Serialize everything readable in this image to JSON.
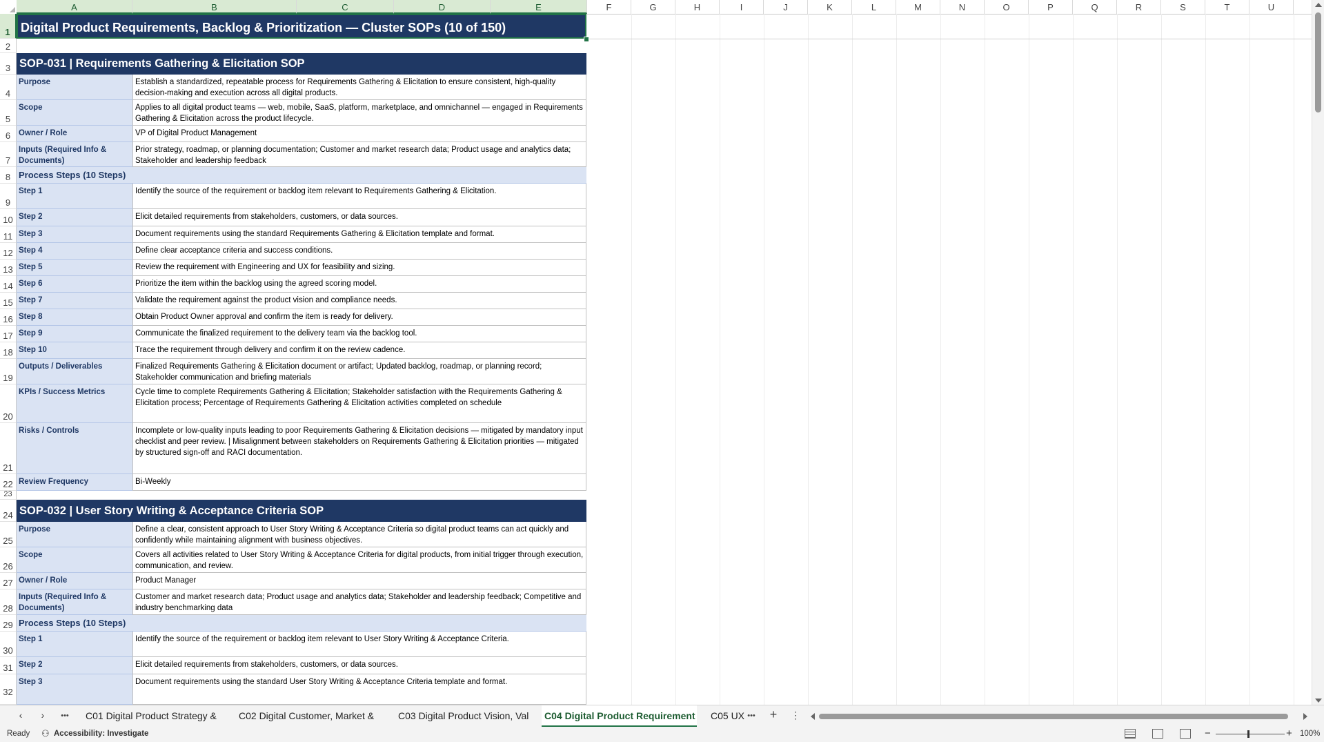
{
  "columns": [
    "A",
    "B",
    "C",
    "D",
    "E",
    "F",
    "G",
    "H",
    "I",
    "J",
    "K",
    "L",
    "M",
    "N",
    "O",
    "P",
    "Q",
    "R",
    "S",
    "T",
    "U"
  ],
  "rows": [
    "1",
    "2",
    "3",
    "4",
    "5",
    "6",
    "7",
    "8",
    "9",
    "10",
    "11",
    "12",
    "13",
    "14",
    "15",
    "16",
    "17",
    "18",
    "19",
    "20",
    "21",
    "22",
    "23",
    "24",
    "25",
    "26",
    "27",
    "28",
    "29",
    "30",
    "31",
    "32"
  ],
  "sheet_title": "Digital Product Requirements, Backlog & Prioritization  —  Cluster SOPs (10 of 150)",
  "sop1": {
    "header": "SOP-031  |  Requirements Gathering & Elicitation SOP",
    "purpose_label": "Purpose",
    "purpose": "Establish a standardized, repeatable process for Requirements Gathering & Elicitation to ensure consistent, high-quality decision-making and execution across all digital products.",
    "scope_label": "Scope",
    "scope": "Applies to all digital product teams — web, mobile, SaaS, platform, marketplace, and omnichannel — engaged in Requirements Gathering & Elicitation across the product lifecycle.",
    "owner_label": "Owner / Role",
    "owner": "VP of Digital Product Management",
    "inputs_label": "Inputs (Required Info & Documents)",
    "inputs": "Prior strategy, roadmap, or planning documentation; Customer and market research data; Product usage and analytics data; Stakeholder and leadership feedback",
    "steps_band": "Process Steps (10 Steps)",
    "steps": [
      {
        "label": "Step 1",
        "text": "Identify the source of the requirement or backlog item relevant to Requirements Gathering & Elicitation."
      },
      {
        "label": "Step 2",
        "text": "Elicit detailed requirements from stakeholders, customers, or data sources."
      },
      {
        "label": "Step 3",
        "text": "Document requirements using the standard Requirements Gathering & Elicitation template and format."
      },
      {
        "label": "Step 4",
        "text": "Define clear acceptance criteria and success conditions."
      },
      {
        "label": "Step 5",
        "text": "Review the requirement with Engineering and UX for feasibility and sizing."
      },
      {
        "label": "Step 6",
        "text": "Prioritize the item within the backlog using the agreed scoring model."
      },
      {
        "label": "Step 7",
        "text": "Validate the requirement against the product vision and compliance needs."
      },
      {
        "label": "Step 8",
        "text": "Obtain Product Owner approval and confirm the item is ready for delivery."
      },
      {
        "label": "Step 9",
        "text": "Communicate the finalized requirement to the delivery team via the backlog tool."
      },
      {
        "label": "Step 10",
        "text": "Trace the requirement through delivery and confirm it on the review cadence."
      }
    ],
    "outputs_label": "Outputs / Deliverables",
    "outputs": "Finalized Requirements Gathering & Elicitation document or artifact; Updated backlog, roadmap, or planning record; Stakeholder communication and briefing materials",
    "kpis_label": "KPIs / Success Metrics",
    "kpis": "Cycle time to complete Requirements Gathering & Elicitation; Stakeholder satisfaction with the Requirements Gathering & Elicitation process; Percentage of Requirements Gathering & Elicitation activities completed on schedule",
    "risks_label": "Risks / Controls",
    "risks": "Incomplete or low-quality inputs leading to poor Requirements Gathering & Elicitation decisions — mitigated by mandatory input checklist and peer review. | Misalignment between stakeholders on Requirements Gathering & Elicitation priorities — mitigated by structured sign-off and RACI documentation.",
    "review_label": "Review Frequency",
    "review": "Bi-Weekly"
  },
  "sop2": {
    "header": "SOP-032  |  User Story Writing & Acceptance Criteria SOP",
    "purpose_label": "Purpose",
    "purpose": "Define a clear, consistent approach to User Story Writing & Acceptance Criteria so digital product teams can act quickly and confidently while maintaining alignment with business objectives.",
    "scope_label": "Scope",
    "scope": "Covers all activities related to User Story Writing & Acceptance Criteria for digital products, from initial trigger through execution, communication, and review.",
    "owner_label": "Owner / Role",
    "owner": "Product Manager",
    "inputs_label": "Inputs (Required Info & Documents)",
    "inputs": "Customer and market research data; Product usage and analytics data; Stakeholder and leadership feedback; Competitive and industry benchmarking data",
    "steps_band": "Process Steps (10 Steps)",
    "steps": [
      {
        "label": "Step 1",
        "text": "Identify the source of the requirement or backlog item relevant to User Story Writing & Acceptance Criteria."
      },
      {
        "label": "Step 2",
        "text": "Elicit detailed requirements from stakeholders, customers, or data sources."
      },
      {
        "label": "Step 3",
        "text": "Document requirements using the standard User Story Writing & Acceptance Criteria template and format."
      }
    ]
  },
  "tabs": [
    "C01 Digital Product Strategy &",
    "C02 Digital Customer, Market &",
    "C03 Digital Product Vision, Val",
    "C04 Digital Product Requirement",
    "C05 UX"
  ],
  "tab_more": "•••",
  "tab_add": "+",
  "tab_menu": "⋮",
  "status": {
    "ready": "Ready",
    "accessibility": "Accessibility: Investigate",
    "zoom": "100%"
  }
}
